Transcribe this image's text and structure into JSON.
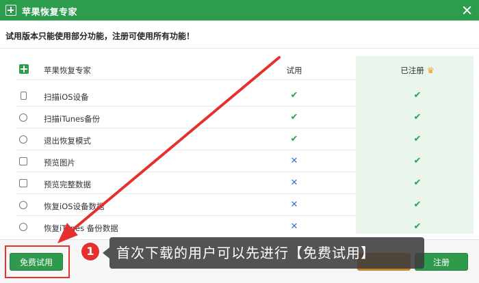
{
  "window": {
    "title": "苹果恢复专家",
    "close_icon": "close-icon"
  },
  "notice": "试用版本只能使用部分功能，注册可使用所有功能！",
  "table": {
    "header": {
      "feature": "苹果恢复专家",
      "trial": "试用",
      "registered": "已注册"
    },
    "rows": [
      {
        "icon": "phone-icon",
        "label": "扫描iOS设备",
        "trial": "✔",
        "registered": "✔"
      },
      {
        "icon": "itunes-icon",
        "label": "扫描iTunes备份",
        "trial": "✔",
        "registered": "✔"
      },
      {
        "icon": "exit-recovery-icon",
        "label": "退出恢复模式",
        "trial": "✔",
        "registered": "✔"
      },
      {
        "icon": "image-icon",
        "label": "预览图片",
        "trial": "✕",
        "registered": "✔"
      },
      {
        "icon": "preview-data-icon",
        "label": "预览完整数据",
        "trial": "✕",
        "registered": "✔"
      },
      {
        "icon": "restore-device-icon",
        "label": "恢复iOS设备数据",
        "trial": "✕",
        "registered": "✔"
      },
      {
        "icon": "restore-itunes-icon",
        "label": "恢复iTunes 备份数据",
        "trial": "✕",
        "registered": "✔"
      }
    ],
    "check_color": "#2aa14e",
    "cross_color": "#2e74c2"
  },
  "buttons": {
    "free_trial": "免费试用",
    "register": "注册"
  },
  "callout": {
    "step": "1",
    "text": "首次下载的用户可以先进行【免费试用】"
  },
  "colors": {
    "accent": "#2c9d4c",
    "annotation": "#e53030"
  }
}
